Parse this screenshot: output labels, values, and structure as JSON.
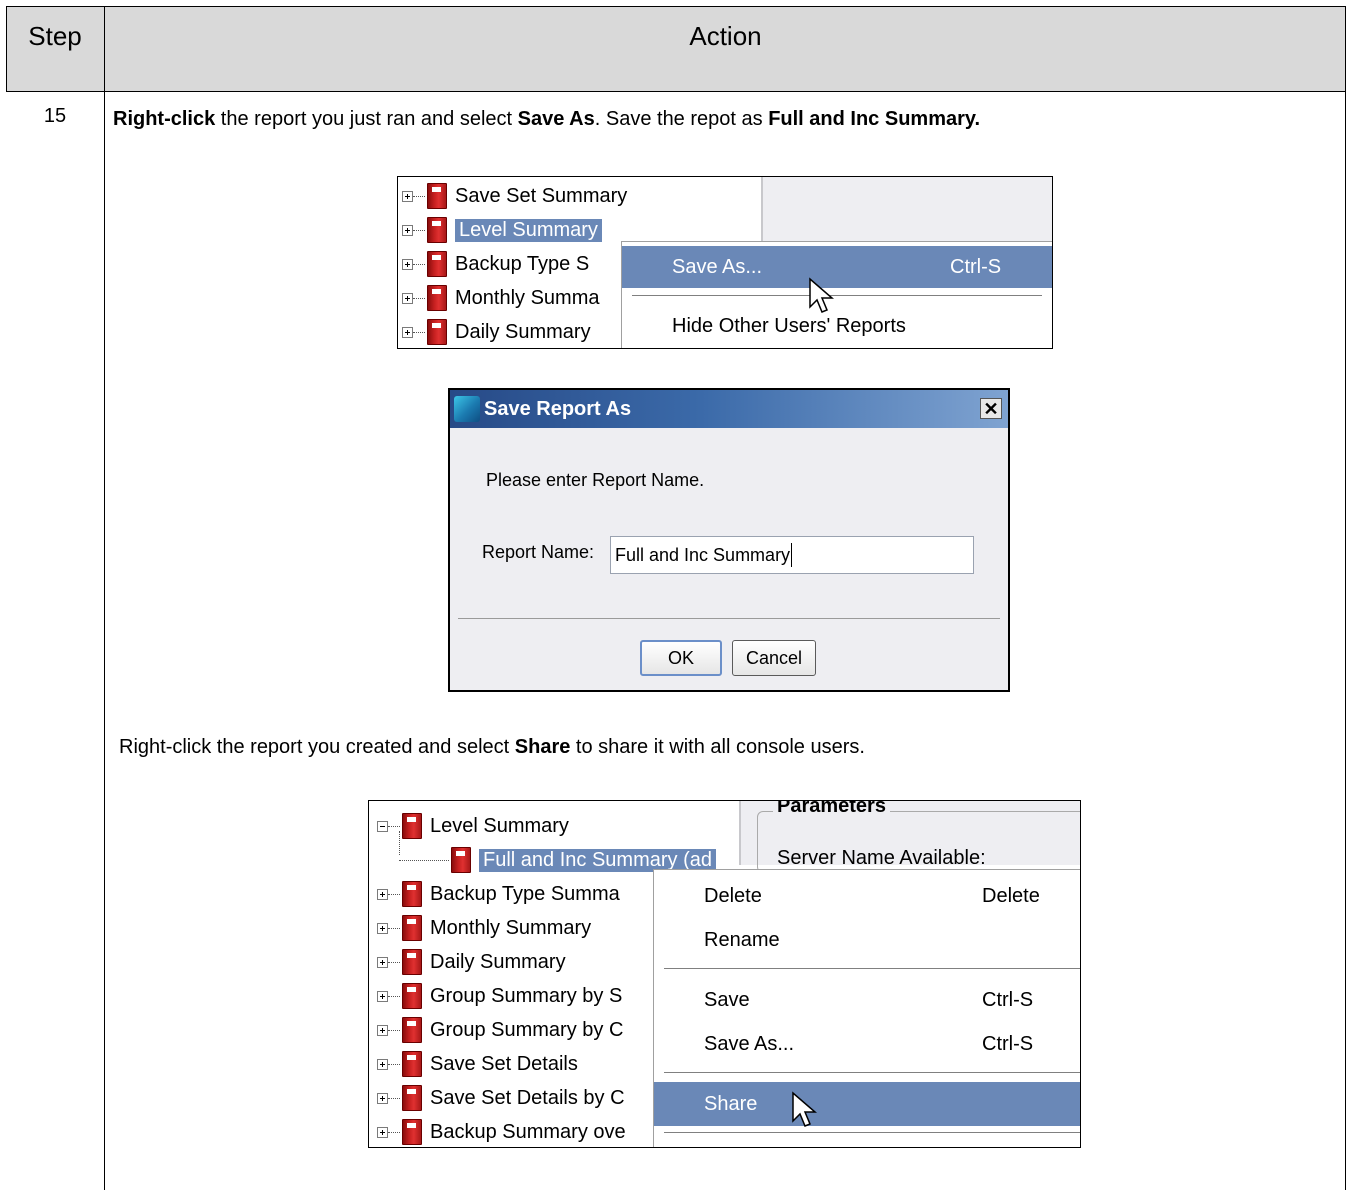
{
  "table": {
    "header": {
      "step": "Step",
      "action": "Action"
    },
    "step_number": "15"
  },
  "instruction1": {
    "part1": "Right-click",
    "part2": " the report you just ran and select ",
    "part3": "Save As",
    "part4": ".  Save the repot as ",
    "part5": "Full and Inc Summary."
  },
  "screenshot1": {
    "tree": [
      "Save Set Summary",
      "Level Summary",
      "Backup Type S",
      "Monthly Summa",
      "Daily Summary"
    ],
    "menu": {
      "save_as": "Save As...",
      "save_as_shortcut": "Ctrl-S",
      "hide_other": "Hide Other Users' Reports"
    }
  },
  "dialog": {
    "title": "Save Report As",
    "close": "✕",
    "prompt": "Please enter Report Name.",
    "field_label": "Report Name:",
    "field_value": "Full and Inc Summary",
    "ok": "OK",
    "cancel": "Cancel"
  },
  "instruction2": {
    "part1": "Right-click the report you created and select ",
    "part2": "Share",
    "part3": " to share it with all console users."
  },
  "screenshot3": {
    "params_title": "Parameters",
    "server_label": "Server Name Available:",
    "tree": [
      "Level Summary",
      "Full and Inc Summary (ad",
      "Backup Type Summa",
      "Monthly Summary",
      "Daily Summary",
      "Group Summary by S",
      "Group Summary by C",
      "Save Set Details",
      "Save Set Details by C",
      "Backup Summary ove"
    ],
    "menu": {
      "delete": "Delete",
      "delete_shortcut": "Delete",
      "rename": "Rename",
      "save": "Save",
      "save_shortcut": "Ctrl-S",
      "save_as": "Save As...",
      "save_as_shortcut": "Ctrl-S",
      "share": "Share"
    }
  },
  "colors": {
    "header_bg": "#d9d9d9",
    "selection": "#6a88b7",
    "titlebar": "#274a87",
    "report_icon": "#c62020"
  }
}
